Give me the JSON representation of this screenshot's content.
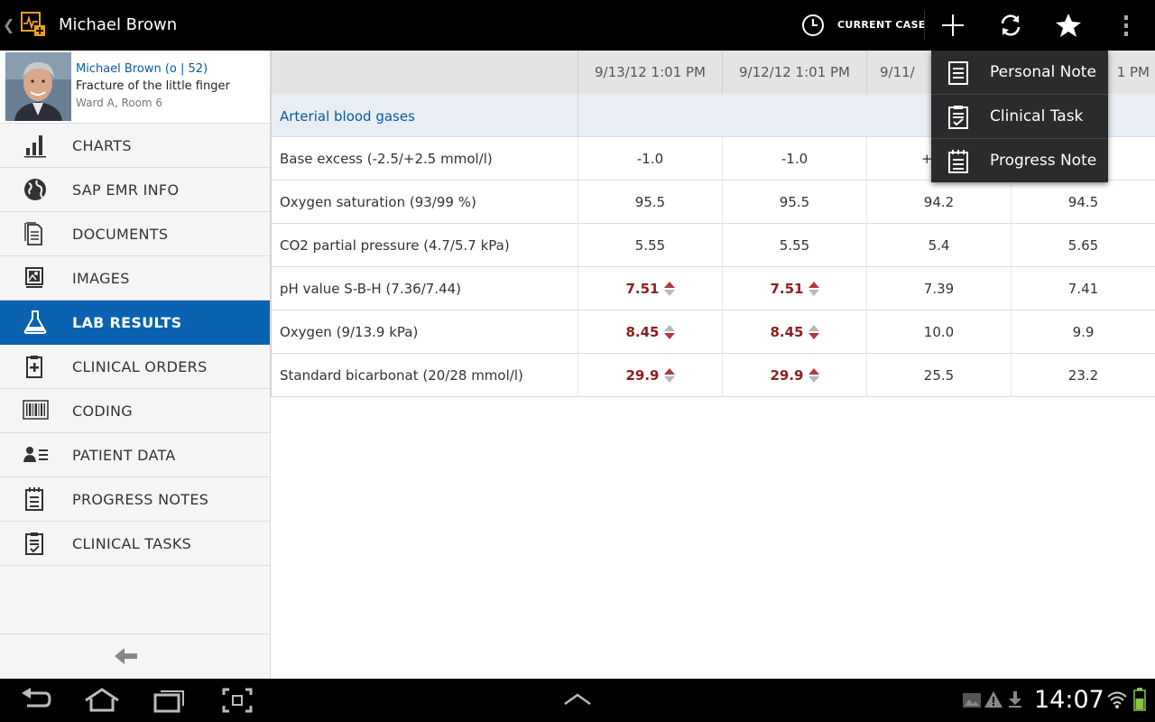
{
  "app": {
    "title": "Michael Brown"
  },
  "action_bar": {
    "current_case_label": "CURRENT CASE",
    "icons": [
      "back-chevron-icon",
      "app-logo-icon",
      "clock-icon",
      "plus-icon",
      "refresh-icon",
      "star-icon",
      "overflow-icon"
    ]
  },
  "patient": {
    "name_line": "Michael Brown (o | 52)",
    "diagnosis": "Fracture of the little finger",
    "location": "Ward A, Room 6"
  },
  "sidebar": {
    "items": [
      {
        "label": "CHARTS",
        "icon": "bar-chart-icon",
        "active": false
      },
      {
        "label": "SAP EMR INFO",
        "icon": "globe-icon",
        "active": false
      },
      {
        "label": "DOCUMENTS",
        "icon": "documents-icon",
        "active": false
      },
      {
        "label": "IMAGES",
        "icon": "image-icon",
        "active": false
      },
      {
        "label": "LAB RESULTS",
        "icon": "flask-icon",
        "active": true
      },
      {
        "label": "CLINICAL ORDERS",
        "icon": "clipboard-plus-icon",
        "active": false
      },
      {
        "label": "CODING",
        "icon": "barcode-icon",
        "active": false
      },
      {
        "label": "PATIENT DATA",
        "icon": "person-list-icon",
        "active": false
      },
      {
        "label": "PROGRESS NOTES",
        "icon": "notepad-icon",
        "active": false
      },
      {
        "label": "CLINICAL TASKS",
        "icon": "clipboard-check-icon",
        "active": false
      }
    ]
  },
  "lab_table": {
    "columns": [
      "9/13/12 1:01 PM",
      "9/12/12 1:01 PM",
      "9/11/",
      "1 PM"
    ],
    "group": "Arterial blood gases",
    "rows": [
      {
        "label": "Base excess (-2.5/+2.5 mmol/l)",
        "values": [
          "-1.0",
          "-1.0",
          "+",
          ""
        ],
        "flags": [
          "",
          "",
          "",
          ""
        ]
      },
      {
        "label": "Oxygen saturation (93/99 %)",
        "values": [
          "95.5",
          "95.5",
          "94.2",
          "94.5"
        ],
        "flags": [
          "",
          "",
          "",
          ""
        ]
      },
      {
        "label": "CO2 partial pressure (4.7/5.7 kPa)",
        "values": [
          "5.55",
          "5.55",
          "5.4",
          "5.65"
        ],
        "flags": [
          "",
          "",
          "",
          ""
        ]
      },
      {
        "label": "pH value S-B-H (7.36/7.44)",
        "values": [
          "7.51",
          "7.51",
          "7.39",
          "7.41"
        ],
        "flags": [
          "high",
          "high",
          "",
          ""
        ]
      },
      {
        "label": "Oxygen (9/13.9 kPa)",
        "values": [
          "8.45",
          "8.45",
          "10.0",
          "9.9"
        ],
        "flags": [
          "low",
          "low",
          "",
          ""
        ]
      },
      {
        "label": "Standard bicarbonat (20/28 mmol/l)",
        "values": [
          "29.9",
          "29.9",
          "25.5",
          "23.2"
        ],
        "flags": [
          "high",
          "high",
          "",
          ""
        ]
      }
    ],
    "flag_colors": {
      "abnormal_text": "#8b1f1f",
      "arrow_active": "#b03a3a",
      "arrow_inactive": "#b8b8b8"
    }
  },
  "popup_menu": {
    "items": [
      {
        "label": "Personal Note",
        "icon": "note-icon"
      },
      {
        "label": "Clinical Task",
        "icon": "task-icon"
      },
      {
        "label": "Progress Note",
        "icon": "progress-note-icon"
      }
    ]
  },
  "system_bar": {
    "time": "14:07",
    "icons": [
      "back-icon",
      "home-icon",
      "recent-apps-icon",
      "screenshot-icon",
      "up-chevron-icon",
      "gallery-notification-icon",
      "warning-icon",
      "download-icon",
      "wifi-icon",
      "battery-icon"
    ]
  },
  "colors": {
    "accent": "#0a62b0",
    "link": "#0a5aa6",
    "header_bg": "#000000",
    "logo": "#f0a020"
  }
}
